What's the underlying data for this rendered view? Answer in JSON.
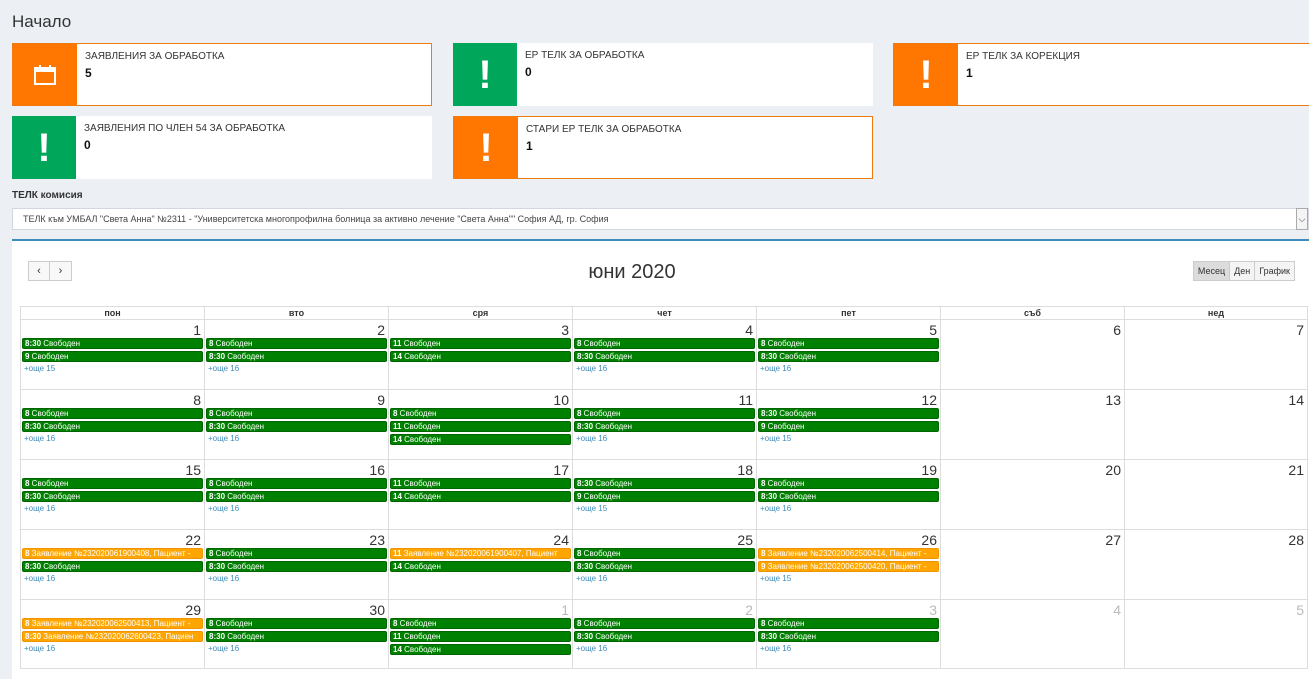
{
  "page_title": "Начало",
  "tiles": [
    {
      "label": "ЗАЯВЛЕНИЯ ЗА ОБРАБОТКА",
      "count": "5",
      "color": "#ff7700",
      "icon": "calendar-icon"
    },
    {
      "label": "ЕР ТЕЛК ЗА ОБРАБОТКА",
      "count": "0",
      "color": "#00a65a",
      "icon": "exclamation-icon"
    },
    {
      "label": "ЕР ТЕЛК ЗА КОРЕКЦИЯ",
      "count": "1",
      "color": "#ff7700",
      "icon": "exclamation-icon"
    },
    {
      "label": "ЗАЯВЛЕНИЯ ПО ЧЛЕН 54 ЗА ОБРАБОТКА",
      "count": "0",
      "color": "#00a65a",
      "icon": "exclamation-icon"
    },
    {
      "label": "СТАРИ ЕР ТЕЛК ЗА ОБРАБОТКА",
      "count": "1",
      "color": "#ff7700",
      "icon": "exclamation-icon"
    }
  ],
  "commission": {
    "label": "ТЕЛК комисия",
    "selected": "ТЕЛК към УМБАЛ \"Света Анна\" №2311 - \"Университетска многопрофилна болница за активно лечение \"Света Анна\"\" София АД, гр. София",
    "arrow": "⌵"
  },
  "calendar": {
    "title": "юни 2020",
    "prev": "‹",
    "next": "›",
    "views": [
      "Месец",
      "Ден",
      "График"
    ],
    "weekdays": [
      "пон",
      "вто",
      "сря",
      "чет",
      "пет",
      "съб",
      "нед"
    ],
    "weeks": [
      [
        {
          "num": "1",
          "events": [
            {
              "t": "8:30",
              "d": "Свободен",
              "c": "green"
            },
            {
              "t": "9",
              "d": "Свободен",
              "c": "green"
            }
          ],
          "more": "+още 15"
        },
        {
          "num": "2",
          "events": [
            {
              "t": "8",
              "d": "Свободен",
              "c": "green"
            },
            {
              "t": "8:30",
              "d": "Свободен",
              "c": "green"
            }
          ],
          "more": "+още 16"
        },
        {
          "num": "3",
          "events": [
            {
              "t": "11",
              "d": "Свободен",
              "c": "green"
            },
            {
              "t": "14",
              "d": "Свободен",
              "c": "green"
            }
          ]
        },
        {
          "num": "4",
          "events": [
            {
              "t": "8",
              "d": "Свободен",
              "c": "green"
            },
            {
              "t": "8:30",
              "d": "Свободен",
              "c": "green"
            }
          ],
          "more": "+още 16"
        },
        {
          "num": "5",
          "events": [
            {
              "t": "8",
              "d": "Свободен",
              "c": "green"
            },
            {
              "t": "8:30",
              "d": "Свободен",
              "c": "green"
            }
          ],
          "more": "+още 16"
        },
        {
          "num": "6",
          "events": []
        },
        {
          "num": "7",
          "events": []
        }
      ],
      [
        {
          "num": "8",
          "events": [
            {
              "t": "8",
              "d": "Свободен",
              "c": "green"
            },
            {
              "t": "8:30",
              "d": "Свободен",
              "c": "green"
            }
          ],
          "more": "+още 16"
        },
        {
          "num": "9",
          "events": [
            {
              "t": "8",
              "d": "Свободен",
              "c": "green"
            },
            {
              "t": "8:30",
              "d": "Свободен",
              "c": "green"
            }
          ],
          "more": "+още 16"
        },
        {
          "num": "10",
          "events": [
            {
              "t": "8",
              "d": "Свободен",
              "c": "green"
            },
            {
              "t": "11",
              "d": "Свободен",
              "c": "green"
            },
            {
              "t": "14",
              "d": "Свободен",
              "c": "green"
            }
          ]
        },
        {
          "num": "11",
          "events": [
            {
              "t": "8",
              "d": "Свободен",
              "c": "green"
            },
            {
              "t": "8:30",
              "d": "Свободен",
              "c": "green"
            }
          ],
          "more": "+още 16"
        },
        {
          "num": "12",
          "events": [
            {
              "t": "8:30",
              "d": "Свободен",
              "c": "green"
            },
            {
              "t": "9",
              "d": "Свободен",
              "c": "green"
            }
          ],
          "more": "+още 15"
        },
        {
          "num": "13",
          "events": []
        },
        {
          "num": "14",
          "events": []
        }
      ],
      [
        {
          "num": "15",
          "events": [
            {
              "t": "8",
              "d": "Свободен",
              "c": "green"
            },
            {
              "t": "8:30",
              "d": "Свободен",
              "c": "green"
            }
          ],
          "more": "+още 16"
        },
        {
          "num": "16",
          "events": [
            {
              "t": "8",
              "d": "Свободен",
              "c": "green"
            },
            {
              "t": "8:30",
              "d": "Свободен",
              "c": "green"
            }
          ],
          "more": "+още 16"
        },
        {
          "num": "17",
          "events": [
            {
              "t": "11",
              "d": "Свободен",
              "c": "green"
            },
            {
              "t": "14",
              "d": "Свободен",
              "c": "green"
            }
          ]
        },
        {
          "num": "18",
          "events": [
            {
              "t": "8:30",
              "d": "Свободен",
              "c": "green"
            },
            {
              "t": "9",
              "d": "Свободен",
              "c": "green"
            }
          ],
          "more": "+още 15"
        },
        {
          "num": "19",
          "events": [
            {
              "t": "8",
              "d": "Свободен",
              "c": "green"
            },
            {
              "t": "8:30",
              "d": "Свободен",
              "c": "green"
            }
          ],
          "more": "+още 16"
        },
        {
          "num": "20",
          "events": []
        },
        {
          "num": "21",
          "events": []
        }
      ],
      [
        {
          "num": "22",
          "events": [
            {
              "t": "8",
              "d": "Заявление №232020061900408, Пациент -",
              "c": "orange"
            },
            {
              "t": "8:30",
              "d": "Свободен",
              "c": "green"
            }
          ],
          "more": "+още 16"
        },
        {
          "num": "23",
          "events": [
            {
              "t": "8",
              "d": "Свободен",
              "c": "green"
            },
            {
              "t": "8:30",
              "d": "Свободен",
              "c": "green"
            }
          ],
          "more": "+още 16"
        },
        {
          "num": "24",
          "events": [
            {
              "t": "11",
              "d": "Заявление №232020061900407, Пациент",
              "c": "orange"
            },
            {
              "t": "14",
              "d": "Свободен",
              "c": "green"
            }
          ]
        },
        {
          "num": "25",
          "events": [
            {
              "t": "8",
              "d": "Свободен",
              "c": "green"
            },
            {
              "t": "8:30",
              "d": "Свободен",
              "c": "green"
            }
          ],
          "more": "+още 16"
        },
        {
          "num": "26",
          "events": [
            {
              "t": "8",
              "d": "Заявление №232020062500414, Пациент -",
              "c": "orange"
            },
            {
              "t": "9",
              "d": "Заявление №232020062500420, Пациент -",
              "c": "orange"
            }
          ],
          "more": "+още 15"
        },
        {
          "num": "27",
          "events": []
        },
        {
          "num": "28",
          "events": []
        }
      ],
      [
        {
          "num": "29",
          "events": [
            {
              "t": "8",
              "d": "Заявление №232020062500413, Пациент -",
              "c": "orange"
            },
            {
              "t": "8:30",
              "d": "Заявление №232020062600423, Пациен",
              "c": "orange"
            }
          ],
          "more": "+още 16"
        },
        {
          "num": "30",
          "events": [
            {
              "t": "8",
              "d": "Свободен",
              "c": "green"
            },
            {
              "t": "8:30",
              "d": "Свободен",
              "c": "green"
            }
          ],
          "more": "+още 16"
        },
        {
          "num": "1",
          "other": true,
          "events": [
            {
              "t": "8",
              "d": "Свободен",
              "c": "green"
            },
            {
              "t": "11",
              "d": "Свободен",
              "c": "green"
            },
            {
              "t": "14",
              "d": "Свободен",
              "c": "green"
            }
          ]
        },
        {
          "num": "2",
          "other": true,
          "events": [
            {
              "t": "8",
              "d": "Свободен",
              "c": "green"
            },
            {
              "t": "8:30",
              "d": "Свободен",
              "c": "green"
            }
          ],
          "more": "+още 16"
        },
        {
          "num": "3",
          "other": true,
          "events": [
            {
              "t": "8",
              "d": "Свободен",
              "c": "green"
            },
            {
              "t": "8:30",
              "d": "Свободен",
              "c": "green"
            }
          ],
          "more": "+още 16"
        },
        {
          "num": "4",
          "other": true,
          "events": []
        },
        {
          "num": "5",
          "other": true,
          "events": []
        }
      ]
    ]
  }
}
